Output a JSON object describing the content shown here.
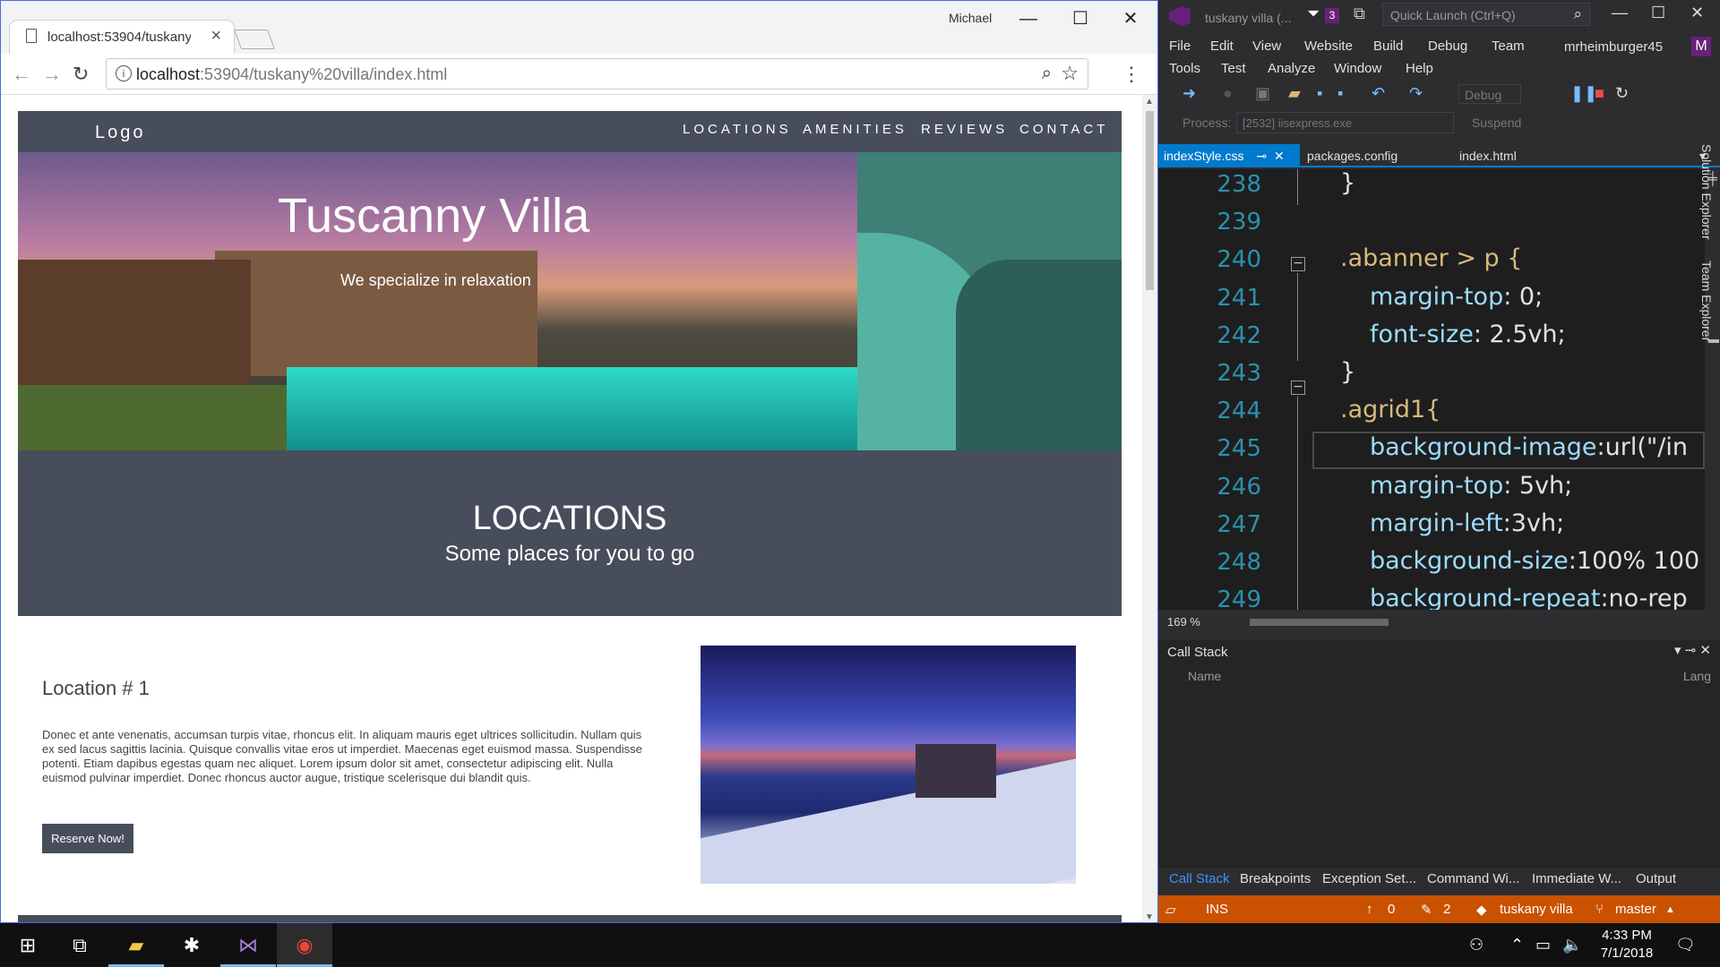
{
  "browser": {
    "tab_title": "localhost:53904/tuskany",
    "user": "Michael",
    "url_host": "localhost",
    "url_rest": ":53904/tuskany%20villa/index.html"
  },
  "site": {
    "logo": "Logo",
    "nav": [
      "LOCATIONS",
      "AMENITIES",
      "REVIEWS",
      "CONTACT"
    ],
    "hero_title": "Tuscanny Villa",
    "hero_subtitle": "We specialize in relaxation",
    "section_title": "LOCATIONS",
    "section_subtitle": "Some places for you to go",
    "loc1_title": "Location # 1",
    "loc1_text": "Donec et ante venenatis, accumsan turpis vitae, rhoncus elit. In aliquam mauris eget ultrices sollicitudin. Nullam quis ex sed lacus sagittis lacinia. Quisque convallis vitae eros ut imperdiet. Maecenas eget euismod massa. Suspendisse potenti. Etiam dapibus egestas quam nec aliquet. Lorem ipsum dolor sit amet, consectetur adipiscing elit. Nulla euismod pulvinar imperdiet. Donec rhoncus auctor augue, tristique scelerisque dui blandit quis.",
    "reserve": "Reserve Now!"
  },
  "vs": {
    "title": "tuskany villa (...",
    "notif_count": "3",
    "quick_launch": "Quick Launch (Ctrl+Q)",
    "menu_row1": [
      "File",
      "Edit",
      "View",
      "Website",
      "Build",
      "Debug",
      "Team"
    ],
    "menu_row2": [
      "Tools",
      "Test",
      "Analyze",
      "Window",
      "Help"
    ],
    "account": "mrheimburger45",
    "avatar": "M",
    "config": "Debug",
    "process_label": "Process:",
    "process": "[2532] iisexpress.exe",
    "suspend": "Suspend",
    "doc_tabs": [
      "indexStyle.css",
      "packages.config",
      "index.html"
    ],
    "code_lines": [
      {
        "n": "238",
        "t": "}"
      },
      {
        "n": "239",
        "t": ""
      },
      {
        "n": "240",
        "sel": ".abanner > p {"
      },
      {
        "n": "241",
        "p": "margin-top",
        "v": ": 0;"
      },
      {
        "n": "242",
        "p": "font-size",
        "v": ": 2.5vh;"
      },
      {
        "n": "243",
        "t": "}"
      },
      {
        "n": "244",
        "sel": ".agrid1{"
      },
      {
        "n": "245",
        "p": "background-image",
        "v": ":url(\"/in"
      },
      {
        "n": "246",
        "p": "margin-top",
        "v": ": 5vh;"
      },
      {
        "n": "247",
        "p": "margin-left",
        "v": ":3vh;"
      },
      {
        "n": "248",
        "p": "background-size",
        "v": ":100% 100"
      },
      {
        "n": "249",
        "p": "background-repeat",
        "v": ":no-rep"
      }
    ],
    "zoom": "169 %",
    "callstack_title": "Call Stack",
    "col_name": "Name",
    "col_lang": "Lang",
    "bottom_tabs": [
      "Call Stack",
      "Breakpoints",
      "Exception Set...",
      "Command Wi...",
      "Immediate W...",
      "Output"
    ],
    "status": {
      "mode": "INS",
      "up": "0",
      "edits": "2",
      "repo": "tuskany villa",
      "branch": "master"
    },
    "side_tabs": [
      "Solution Explorer",
      "Team Explorer"
    ],
    "status_color": "#ca5100",
    "accent": "#007acc"
  },
  "taskbar": {
    "time": "4:33 PM",
    "date": "7/1/2018"
  }
}
